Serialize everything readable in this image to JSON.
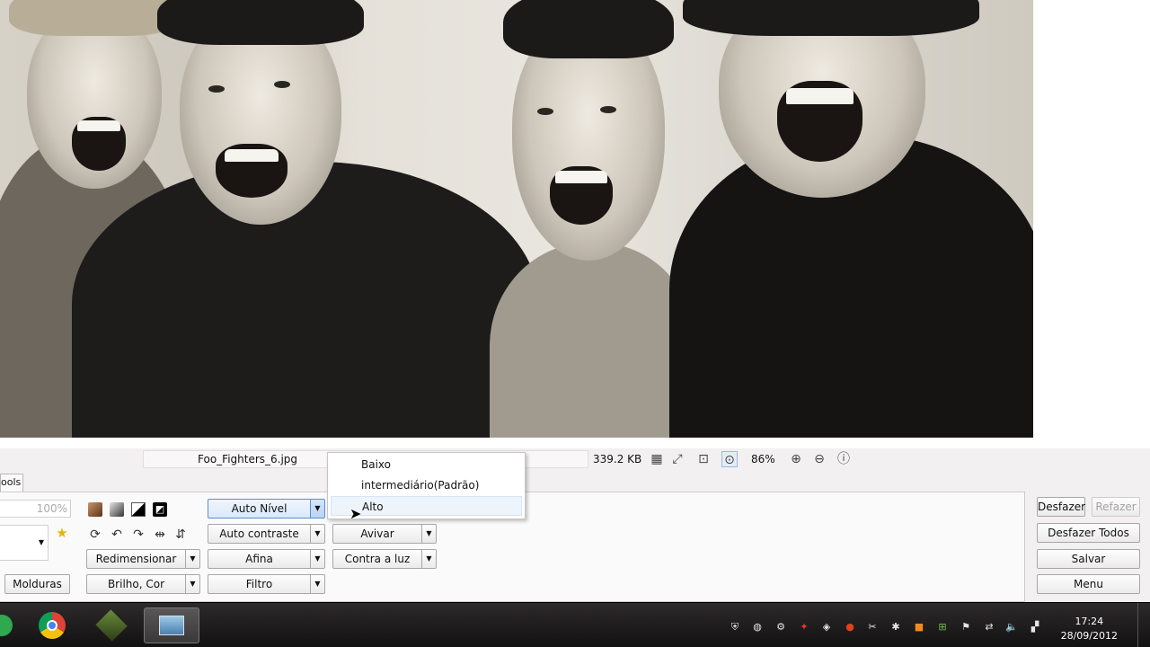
{
  "status_bar": {
    "filename": "Foo_Fighters_6.jpg",
    "filesize": "339.2 KB",
    "zoom": "86%"
  },
  "tabs": {
    "tools_tab": "ools"
  },
  "tools": {
    "size_value": "100%",
    "auto_level": "Auto Nível",
    "auto_contrast": "Auto contraste",
    "brighten": "Avivar",
    "backlight": "Contra a luz",
    "resize": "Redimensionar",
    "sharpen": "Afina",
    "brightness_color": "Brilho, Cor",
    "filter": "Filtro",
    "frames": "Molduras"
  },
  "dropdown": {
    "items": [
      "Baixo",
      "intermediário(Padrão)",
      "Alto"
    ],
    "hovered": "Alto"
  },
  "actions": {
    "undo": "Desfazer",
    "redo": "Refazer",
    "undo_all": "Desfazer Todos",
    "save": "Salvar",
    "menu": "Menu"
  },
  "taskbar": {
    "time": "17:24",
    "date": "28/09/2012"
  },
  "colors": {
    "accent_blue": "#5a8fd0",
    "taskbar": "#1e1c1d"
  }
}
